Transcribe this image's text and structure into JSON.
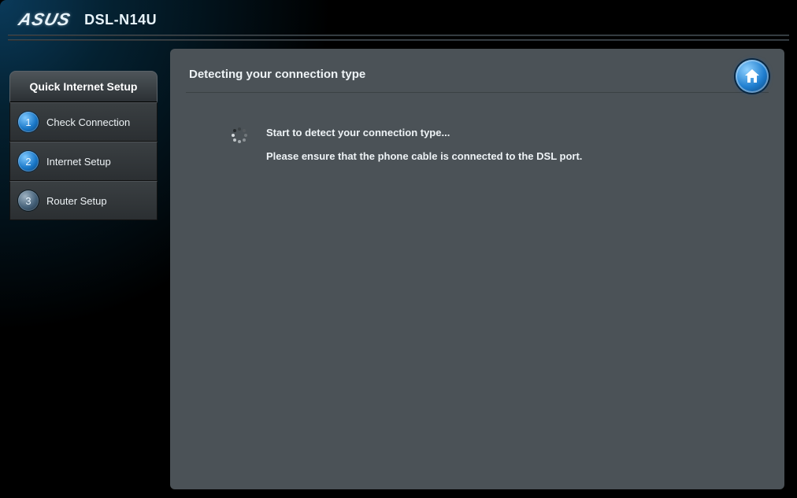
{
  "header": {
    "brand": "ASUS",
    "model": "DSL-N14U"
  },
  "sidebar": {
    "title": "Quick Internet Setup",
    "items": [
      {
        "num": "1",
        "label": "Check Connection",
        "active": true
      },
      {
        "num": "2",
        "label": "Internet Setup",
        "active": true
      },
      {
        "num": "3",
        "label": "Router Setup",
        "active": false
      }
    ]
  },
  "panel": {
    "title": "Detecting your connection type",
    "line1": "Start to detect your connection type...",
    "line2": "Please ensure that the phone cable is connected to the DSL port.",
    "home_icon": "home-icon"
  }
}
